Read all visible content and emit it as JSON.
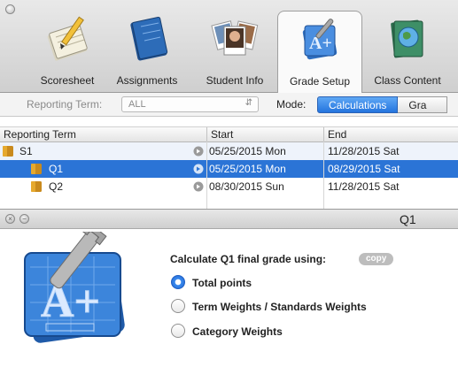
{
  "tabs": [
    {
      "label": "Scoresheet",
      "icon": "scoresheet-icon"
    },
    {
      "label": "Assignments",
      "icon": "assignments-icon"
    },
    {
      "label": "Student Info",
      "icon": "student-info-icon"
    },
    {
      "label": "Grade Setup",
      "icon": "grade-setup-icon",
      "active": true
    },
    {
      "label": "Class Content",
      "icon": "class-content-icon"
    }
  ],
  "filter": {
    "reporting_term_label": "Reporting Term:",
    "reporting_term_value": "ALL",
    "mode_label": "Mode:",
    "mode_options": [
      "Calculations",
      "Gra"
    ]
  },
  "grid": {
    "headers": [
      "Reporting Term",
      "Start",
      "End"
    ],
    "rows": [
      {
        "term": "S1",
        "start": "05/25/2015 Mon",
        "end": "11/28/2015 Sat"
      },
      {
        "term": "Q1",
        "start": "05/25/2015 Mon",
        "end": "08/29/2015 Sat",
        "selected": true
      },
      {
        "term": "Q2",
        "start": "08/30/2015 Sun",
        "end": "11/28/2015 Sat"
      }
    ]
  },
  "panel": {
    "title": "Q1",
    "calc_prompt": "Calculate Q1 final grade using:",
    "copy_label": "copy",
    "options": [
      "Total points",
      "Term Weights / Standards Weights",
      "Category Weights"
    ],
    "selected_option": "Total points"
  },
  "colors": {
    "accent": "#2b74d6",
    "selection": "#2b74d6"
  }
}
